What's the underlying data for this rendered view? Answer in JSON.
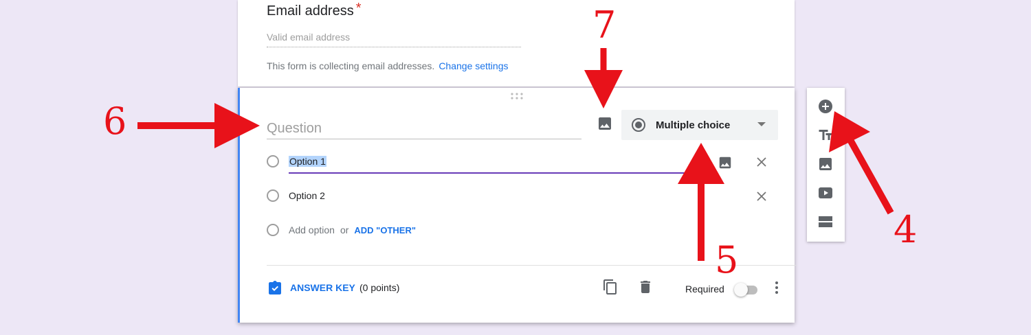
{
  "email_card": {
    "title": "Email address",
    "required_mark": "*",
    "placeholder": "Valid email address",
    "note": "This form is collecting email addresses.",
    "change_settings": "Change settings"
  },
  "question_card": {
    "question_placeholder": "Question",
    "type_select_label": "Multiple choice",
    "options": [
      {
        "label": "Option 1"
      },
      {
        "label": "Option 2"
      }
    ],
    "add_option": "Add option",
    "or_text": "or",
    "add_other": "ADD \"OTHER\"",
    "answer_key": "ANSWER KEY",
    "points": "(0 points)",
    "required_label": "Required",
    "required_on": false
  },
  "side_toolbar": {
    "icons": [
      "add-question-icon",
      "title-text-icon",
      "image-icon",
      "video-icon",
      "section-icon"
    ]
  },
  "annotations": {
    "labels": [
      "4",
      "5",
      "6",
      "7"
    ],
    "color": "#e8121a"
  },
  "colors": {
    "background": "#ede7f6",
    "accent_blue": "#1a73e8",
    "focus_purple": "#673ab7",
    "left_border": "#4285f4"
  }
}
